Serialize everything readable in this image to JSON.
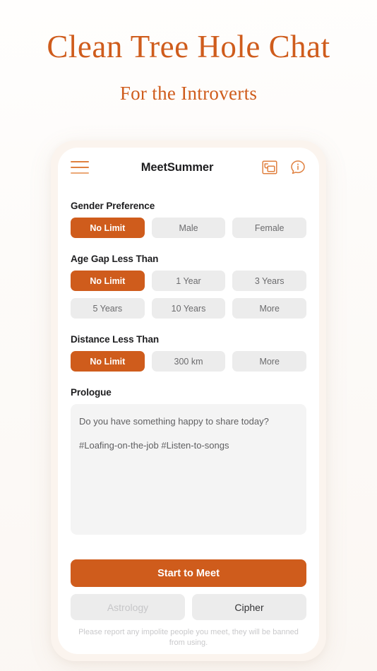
{
  "hero": {
    "title": "Clean Tree Hole Chat",
    "subtitle": "For the Introverts"
  },
  "colors": {
    "accent": "#CF5C1C",
    "chip_bg": "#ECECEC",
    "chip_text": "#6C6C6E",
    "page_bg": "#FDFBF9",
    "phone_frame": "#FBF4EE",
    "screen_bg": "#FFFFFF",
    "prologue_bg": "#F4F4F4",
    "disabled_text": "#C6C6C8"
  },
  "appbar": {
    "title": "MeetSummer",
    "menu_icon": "hamburger-menu-icon",
    "gallery_icon": "photo-cards-icon",
    "info_icon": "info-bubble-icon"
  },
  "sections": [
    {
      "label": "Gender Preference",
      "rows": [
        [
          {
            "label": "No Limit",
            "selected": true
          },
          {
            "label": "Male",
            "selected": false
          },
          {
            "label": "Female",
            "selected": false
          }
        ]
      ]
    },
    {
      "label": "Age Gap Less Than",
      "rows": [
        [
          {
            "label": "No Limit",
            "selected": true
          },
          {
            "label": "1 Year",
            "selected": false
          },
          {
            "label": "3 Years",
            "selected": false
          }
        ],
        [
          {
            "label": "5 Years",
            "selected": false
          },
          {
            "label": "10 Years",
            "selected": false
          },
          {
            "label": "More",
            "selected": false
          }
        ]
      ]
    },
    {
      "label": "Distance Less Than",
      "rows": [
        [
          {
            "label": "No Limit",
            "selected": true
          },
          {
            "label": "300 km",
            "selected": false
          },
          {
            "label": "More",
            "selected": false
          }
        ]
      ]
    }
  ],
  "prologue": {
    "label": "Prologue",
    "lines": [
      "Do you have something happy to share today?",
      "#Loafing-on-the-job #Listen-to-songs"
    ]
  },
  "actions": {
    "primary_label": "Start to Meet",
    "secondary": [
      {
        "label": "Astrology",
        "disabled": true
      },
      {
        "label": "Cipher",
        "disabled": false
      }
    ]
  },
  "disclaimer": "Please report any impolite people you meet, they will be banned from using."
}
